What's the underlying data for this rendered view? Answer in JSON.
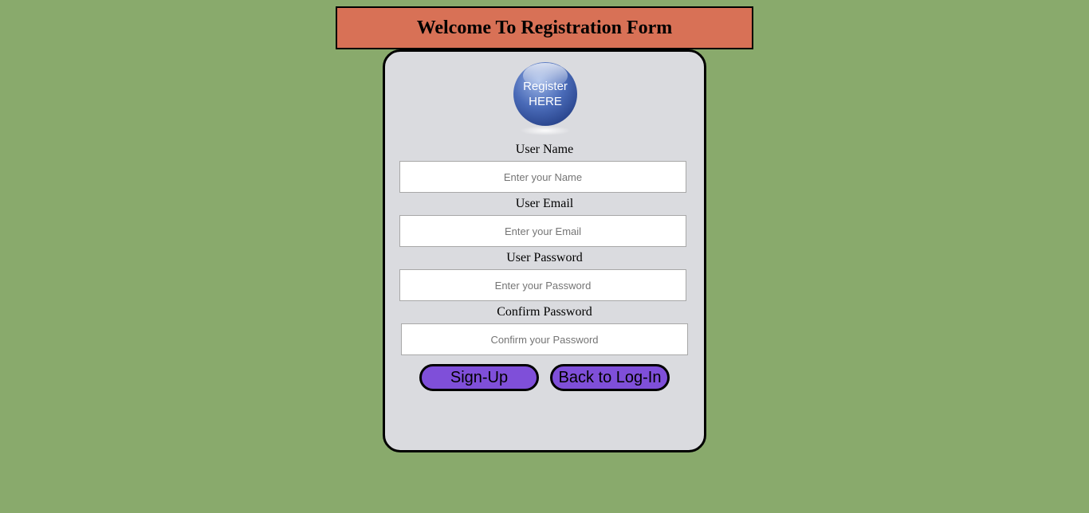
{
  "header": {
    "title": "Welcome To Registration Form"
  },
  "logo": {
    "line1": "Register",
    "line2": "HERE"
  },
  "form": {
    "fields": [
      {
        "label": "User Name",
        "placeholder": "Enter your Name",
        "value": ""
      },
      {
        "label": "User Email",
        "placeholder": "Enter your Email",
        "value": ""
      },
      {
        "label": "User Password",
        "placeholder": "Enter your Password",
        "value": ""
      },
      {
        "label": "Confirm Password",
        "placeholder": "Confirm your Password",
        "value": ""
      }
    ],
    "signup_label": "Sign-Up",
    "back_label": "Back to Log-In"
  },
  "colors": {
    "page_background": "#89aa6c",
    "header_background": "#d87156",
    "card_background": "#dadbdf",
    "button_background": "#7f4fd9"
  }
}
